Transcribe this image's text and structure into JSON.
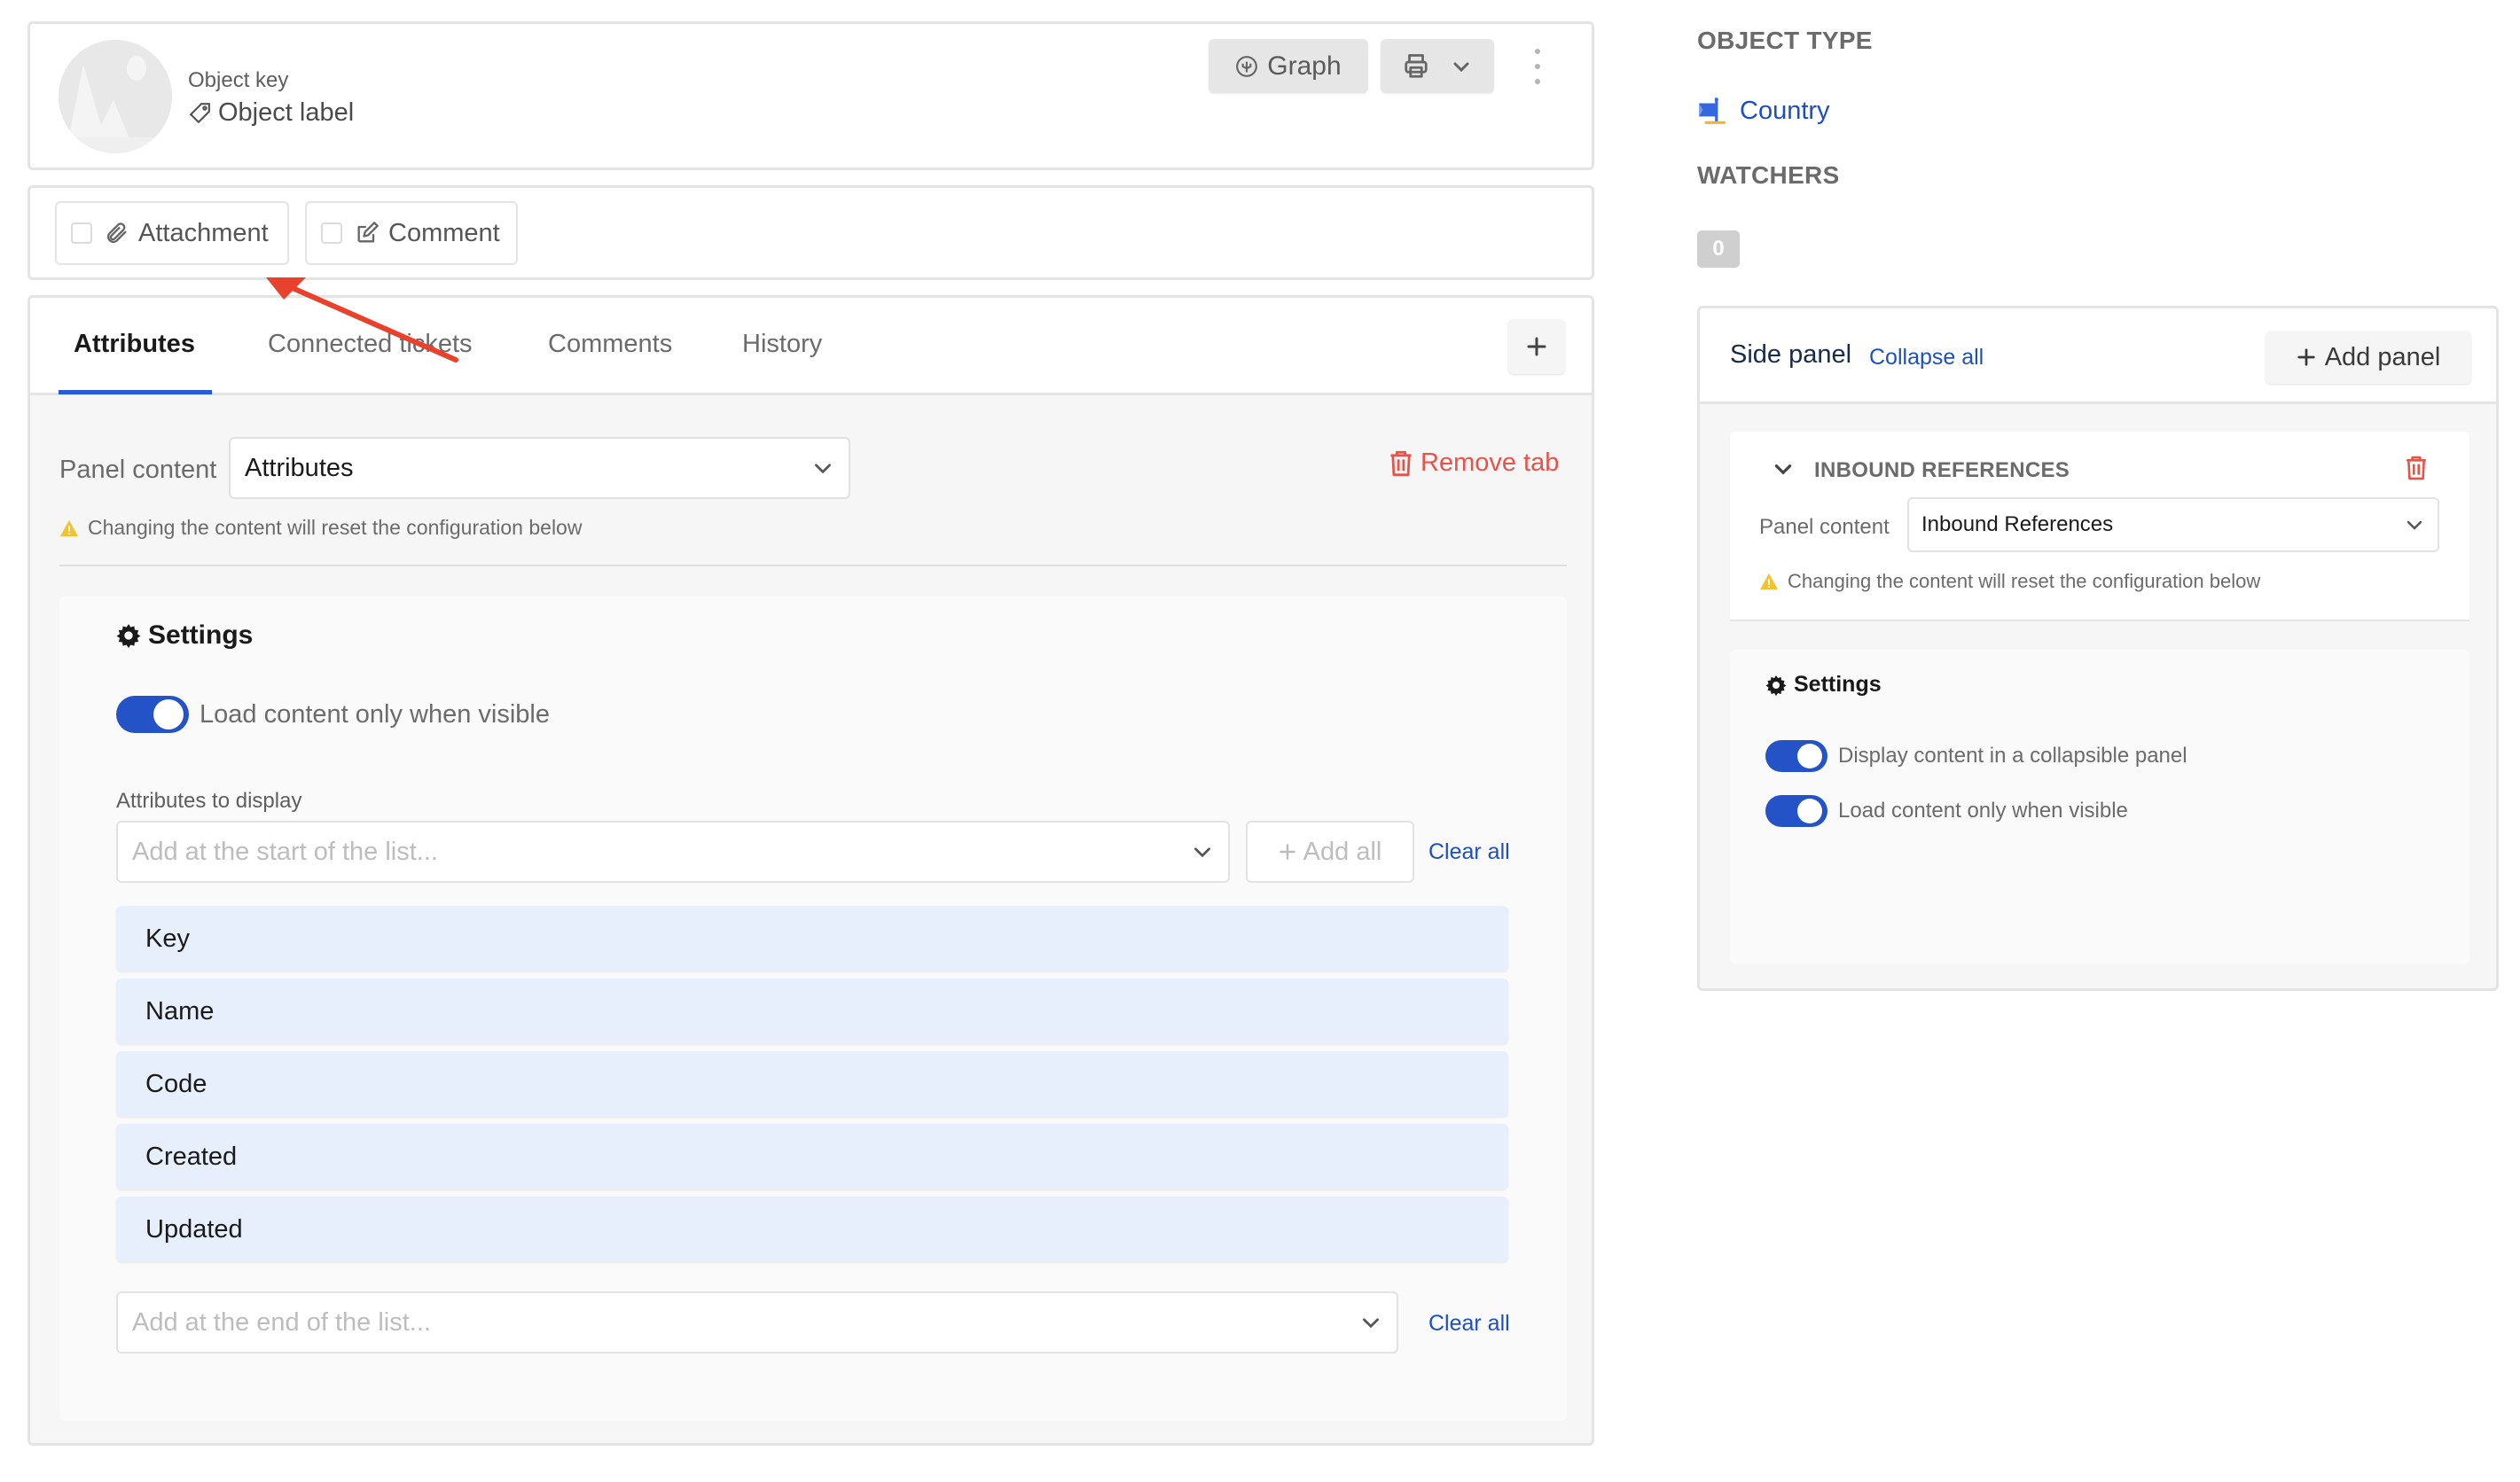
{
  "header": {
    "object_key": "Object key",
    "object_label": "Object label",
    "graph_label": "Graph",
    "icons": {
      "avatar": "image-placeholder-icon",
      "label": "tag-icon",
      "graph": "graph-icon",
      "print": "printer-icon",
      "dropdown": "chevron-down-icon",
      "more": "more-vertical-icon"
    }
  },
  "actions": {
    "attachment_label": "Attachment",
    "comment_label": "Comment"
  },
  "tabs": {
    "items": [
      {
        "label": "Attributes",
        "active": true
      },
      {
        "label": "Connected tickets",
        "active": false
      },
      {
        "label": "Comments",
        "active": false
      },
      {
        "label": "History",
        "active": false
      }
    ],
    "add_tab_icon": "plus-icon"
  },
  "tab_panel": {
    "panel_content_label": "Panel content",
    "panel_content_value": "Attributes",
    "remove_tab_label": "Remove tab",
    "warning_text": "Changing the content will reset the configuration below",
    "settings_title": "Settings",
    "load_visible_label": "Load content only when visible",
    "load_visible_on": true,
    "attributes_label": "Attributes to display",
    "start_placeholder": "Add at the start of the list...",
    "add_all_label": "Add all",
    "clear_all_label": "Clear all",
    "attributes": [
      "Key",
      "Name",
      "Code",
      "Created",
      "Updated"
    ],
    "end_placeholder": "Add at the end of the list..."
  },
  "sidebar": {
    "object_type_heading": "OBJECT TYPE",
    "object_type_value": "Country",
    "watchers_heading": "WATCHERS",
    "watchers_count": "0",
    "side_panel": {
      "title": "Side panel",
      "collapse_all_label": "Collapse all",
      "add_panel_label": "Add panel",
      "panels": [
        {
          "title": "INBOUND REFERENCES",
          "panel_content_label": "Panel content",
          "panel_content_value": "Inbound References",
          "warning_text": "Changing the content will reset the configuration below",
          "settings_title": "Settings",
          "toggles": [
            {
              "label": "Display content in a collapsible panel",
              "on": true
            },
            {
              "label": "Load content only when visible",
              "on": true
            }
          ]
        }
      ]
    }
  },
  "colors": {
    "accent": "#2453c8",
    "link": "#1d4fc4",
    "danger": "#e5534b",
    "warning": "#f2c230",
    "attribute_bg": "#e8effc",
    "annotation_arrow": "#e8412c"
  }
}
